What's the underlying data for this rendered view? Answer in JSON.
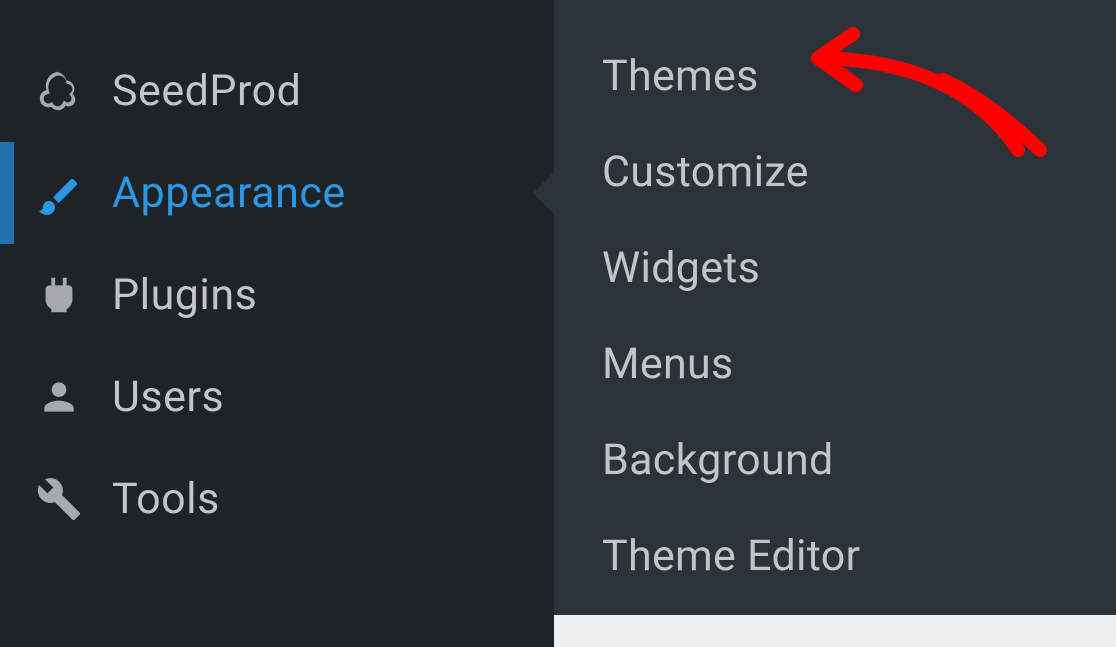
{
  "sidebar": {
    "items": [
      {
        "label": "SeedProd"
      },
      {
        "label": "Appearance"
      },
      {
        "label": "Plugins"
      },
      {
        "label": "Users"
      },
      {
        "label": "Tools"
      }
    ]
  },
  "submenu": {
    "items": [
      {
        "label": "Themes"
      },
      {
        "label": "Customize"
      },
      {
        "label": "Widgets"
      },
      {
        "label": "Menus"
      },
      {
        "label": "Background"
      },
      {
        "label": "Theme Editor"
      }
    ]
  }
}
